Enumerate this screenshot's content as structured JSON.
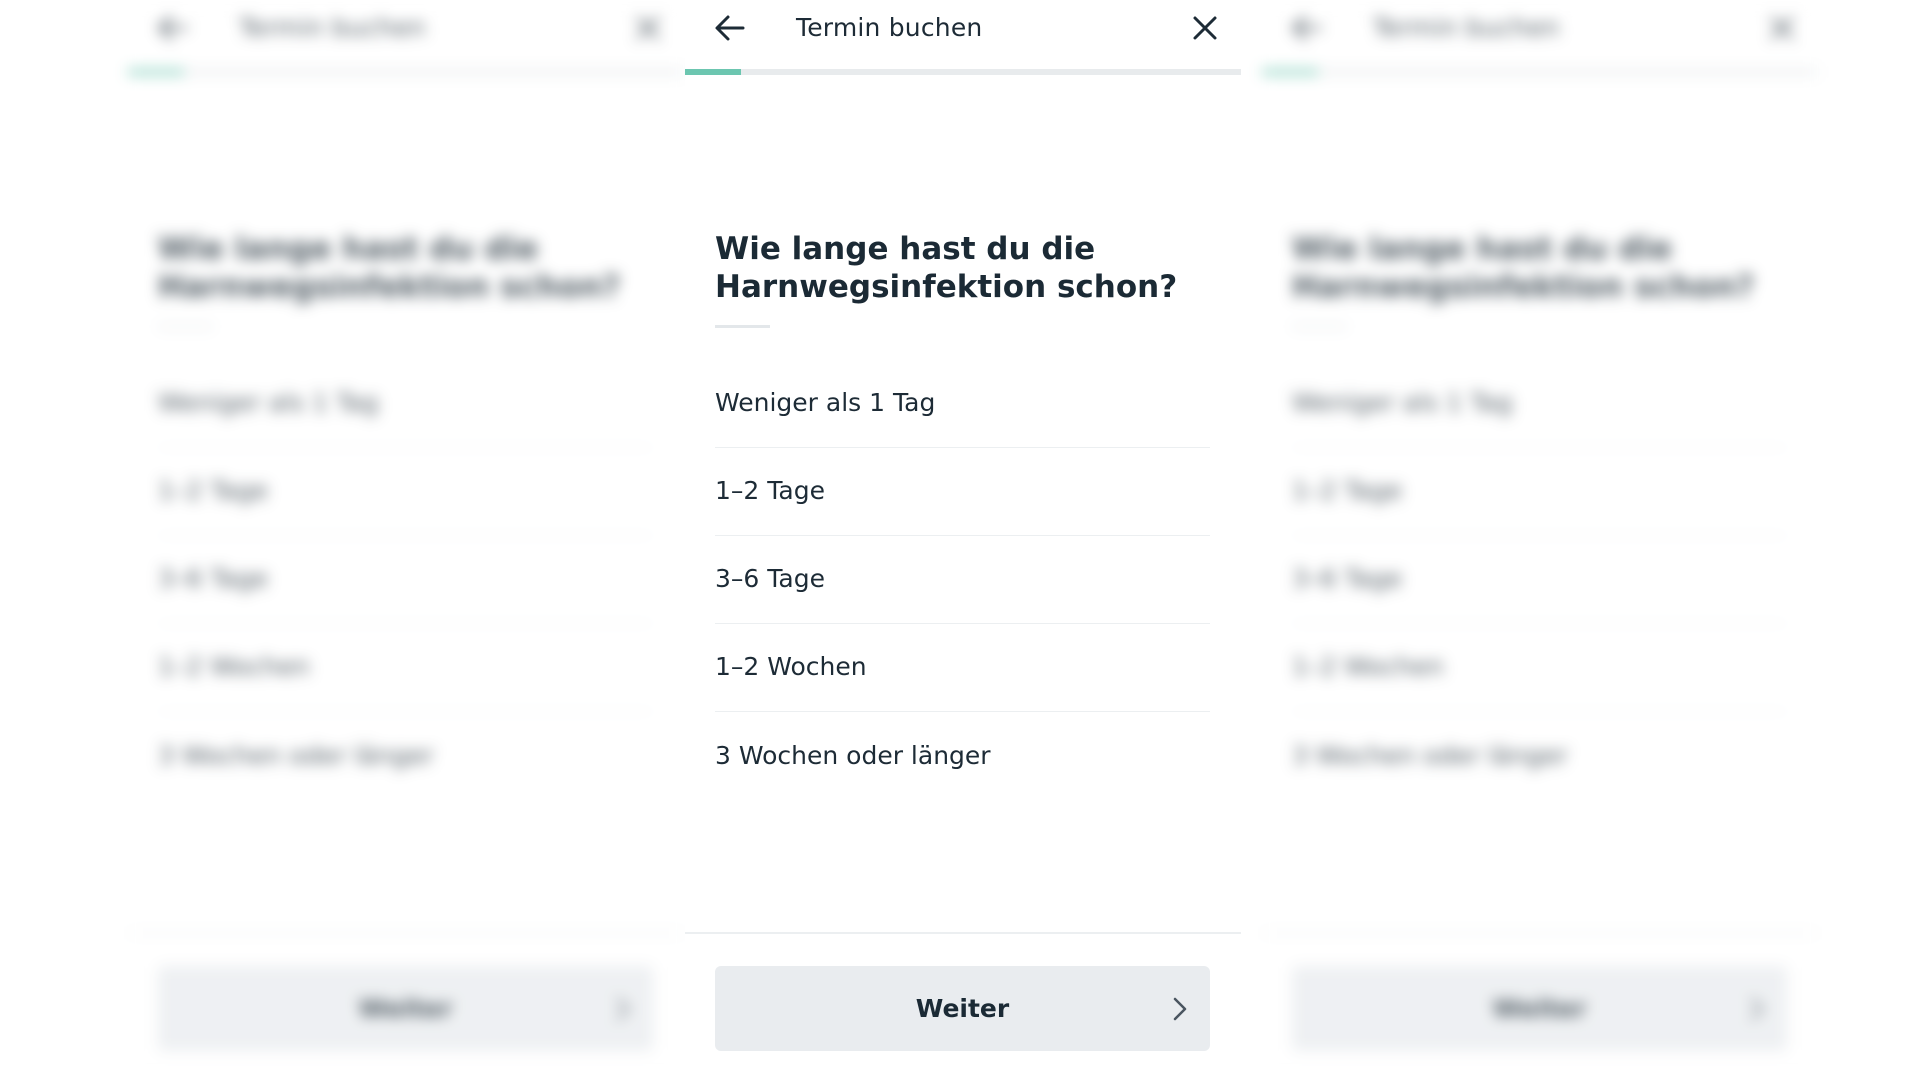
{
  "header": {
    "title": "Termin buchen",
    "back_icon": "arrow-left-icon",
    "close_icon": "close-icon"
  },
  "progress": {
    "fraction": 0.1
  },
  "question": {
    "title": "Wie lange hast du die Harnwegsinfektion schon?"
  },
  "options": [
    {
      "label": "Weniger als 1 Tag"
    },
    {
      "label": "1–2 Tage"
    },
    {
      "label": "3–6 Tage"
    },
    {
      "label": "1–2 Wochen"
    },
    {
      "label": "3 Wochen oder länger"
    }
  ],
  "footer": {
    "next_label": "Weiter",
    "next_icon": "chevron-right-icon"
  },
  "colors": {
    "accent": "#6cc6b0",
    "text": "#1d2b36",
    "button_bg": "#e9ecef",
    "divider": "#eceff1"
  }
}
